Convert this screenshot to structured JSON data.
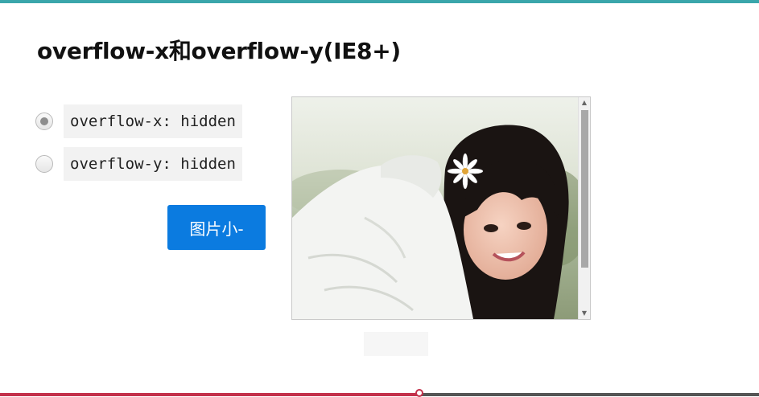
{
  "title": "overflow-x和overflow-y(IE8+)",
  "options": [
    {
      "label": "overflow-x: hidden",
      "checked": true
    },
    {
      "label": "overflow-y: hidden",
      "checked": false
    }
  ],
  "button_label": "图片小-",
  "video_progress": 0.553,
  "colors": {
    "accent_top": "#3aa6ab",
    "button": "#0b7be0",
    "progress": "#c3314b"
  }
}
